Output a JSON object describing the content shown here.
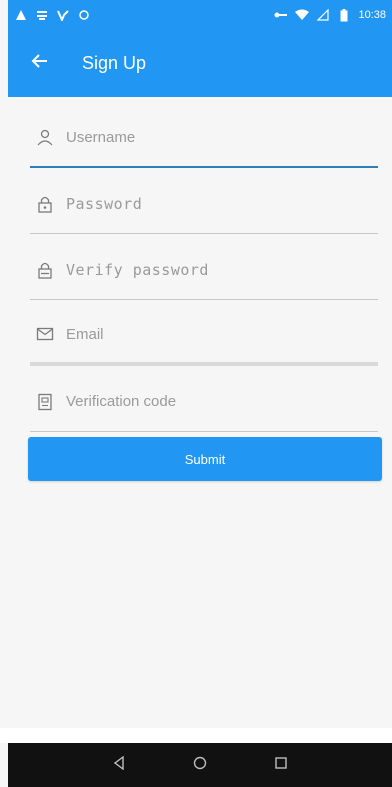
{
  "status_bar": {
    "time": "10:38",
    "icons": [
      "warning-icon",
      "notification-icon",
      "vpn-icon",
      "sync-icon",
      "key-icon",
      "wifi-icon",
      "signal-icon",
      "battery-icon"
    ]
  },
  "app_bar": {
    "title": "Sign Up",
    "back_icon": "arrow-left-icon"
  },
  "form": {
    "username": {
      "placeholder": "Username",
      "value": "",
      "icon": "user-icon"
    },
    "password": {
      "placeholder": "Password",
      "value": "",
      "icon": "lock-icon"
    },
    "verify_password": {
      "placeholder": "Verify password",
      "value": "",
      "icon": "lock-icon"
    },
    "email": {
      "placeholder": "Email",
      "value": "",
      "icon": "mail-icon"
    },
    "verification_code": {
      "placeholder": "Verification code",
      "value": "",
      "icon": "shield-icon"
    },
    "submit_label": "Submit"
  },
  "nav_bar": {
    "buttons": [
      "back-triangle-icon",
      "home-circle-icon",
      "recents-square-icon"
    ]
  },
  "colors": {
    "primary": "#2196f3",
    "focused_underline": "#2e7fb3",
    "nav_bar": "#111111"
  }
}
